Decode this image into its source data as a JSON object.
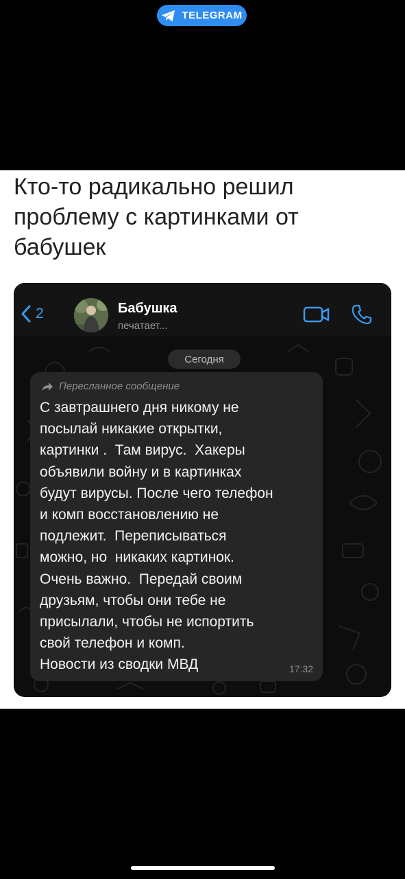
{
  "badge": {
    "label": "TELEGRAM",
    "icon": "telegram-plane-icon",
    "color": "#2f8cf0"
  },
  "post": {
    "caption": "Кто-то радикально решил\nпроблему с картинками от\nбабушек"
  },
  "chat": {
    "back_count": "2",
    "contact_name": "Бабушка",
    "contact_status": "печатает...",
    "date_label": "Сегодня",
    "message": {
      "forwarded_label": "Пересланное сообщение",
      "text": "С завтрашнего дня никому не\nпосылай никакие открытки,\nкартинки .  Там вирус.  Хакеры\nобъявили войну и в картинках\nбудут вирусы. После чего телефон\nи комп восстановлению не\nподлежит.  Переписываться\nможно, но  никаких картинок.\nОчень важно.  Передай своим\nдрузьям, чтобы они тебе не\nприсылали, чтобы не испортить\nсвой телефон и комп.\nНовости из сводки МВД",
      "time": "17:32"
    },
    "accent_color": "#3a9bf0"
  }
}
